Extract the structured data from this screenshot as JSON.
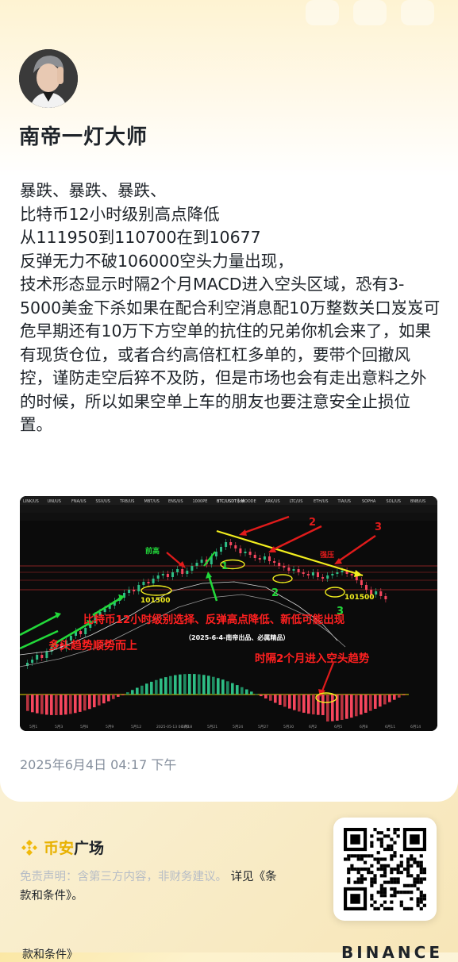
{
  "author": {
    "name": "南帝一灯大师"
  },
  "post": {
    "lines": [
      "暴跌、暴跌、暴跌、",
      "比特币12小时级别高点降低",
      "从111950到110700在到10677",
      "反弹无力不破106000空头力量出现，",
      "技术形态显示时隔2个月MACD进入空头区域，恐有3-5000美金下杀如果在配合利空消息配10万整数关口岌岌可危早期还有10万下方空单的抗住的兄弟你机会来了，如果有现货仓位，或者合约高倍杠杠多单的，要带个回撤风控，谨防走空后猝不及防，但是市场也会有走出意料之外的时候，所以如果空单上车的朋友也要注意安全止损位置。"
    ]
  },
  "chart_image": {
    "annotations": {
      "label_prev_high": "前高",
      "label_resistance": "强压",
      "label_101500_a": "101500",
      "label_101500_b": "101500",
      "num_1": "1",
      "num_2": "2",
      "num_3": "3",
      "num_2b": "2",
      "num_3b": "3",
      "headline": "比特币12小时级别选择、反弹高点降低、新低可能出现",
      "credit": "（2025-6-4-南帝出品、必属精品）",
      "bull_trend": "多头趋势顺势而上",
      "bear_note": "时隔2个月进入空头趋势"
    },
    "ticker_bar": [
      "LINK/US",
      "UNI/US",
      "FNA/US",
      "SSV/US",
      "TRB/US",
      "MBT/US",
      "ENS/US",
      "1000PE",
      "BTC/USDT永续",
      "MOODE",
      "ARK/US",
      "LTC/US",
      "ETH/US",
      "TIA/US",
      "SOPHA",
      "SOL/US",
      "BNB/US"
    ],
    "date_axis": [
      "5月1",
      "5月3",
      "5月6",
      "5月9",
      "5月12",
      "2025-05-13 08:00",
      "5月18",
      "5月21",
      "5月24",
      "5月27",
      "5月30",
      "6月2",
      "6月5",
      "6月8",
      "6月11",
      "6月14"
    ]
  },
  "timestamp": "2025年6月4日 04:17 下午",
  "brand": {
    "part1": "币安",
    "part2": "广场"
  },
  "disclaimer": {
    "text": "免责声明：含第三方内容，非财务建议。",
    "link": "详见《条款和条件》。"
  },
  "footer": {
    "left": "款和条件》",
    "right": "BINANCE"
  },
  "colors": {
    "brand_yellow": "#f0b90b",
    "text_dark": "#1e2329",
    "text_muted": "#848e9c"
  }
}
